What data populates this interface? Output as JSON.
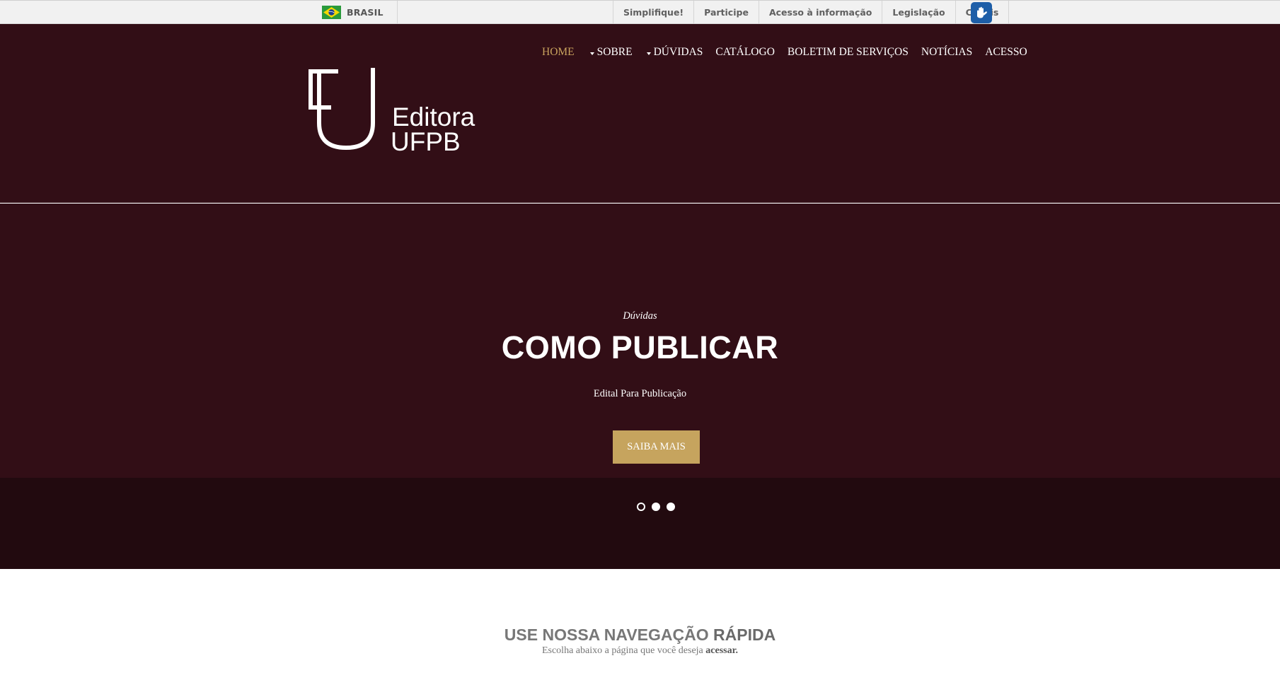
{
  "gov_bar": {
    "country_label": "BRASIL",
    "flag_icon": "brazil-flag-icon",
    "links": [
      "Simplifique!",
      "Participe",
      "Acesso à informação",
      "Legislação",
      "Canais"
    ],
    "accessibility_icon": "vlibras-hands-icon"
  },
  "header": {
    "nav": {
      "home": "HOME",
      "sobre": "SOBRE",
      "duvidas": "DÚVIDAS",
      "catalogo": "CATÁLOGO",
      "boletim": "BOLETIM DE SERVIÇOS",
      "noticias": "NOTÍCIAS",
      "acesso": "ACESSO"
    },
    "logo": {
      "line1": "Editora",
      "line2": "UFPB"
    }
  },
  "hero": {
    "kicker": "Dúvidas",
    "title": "COMO PUBLICAR",
    "subtitle": "Edital Para Publicação",
    "button": "SAIBA MAIS",
    "slides_total": 3,
    "current_slide": 1
  },
  "quick_nav": {
    "title_prefix": "USE NOSSA NAVEGAÇÃO",
    "title_strong": "RÁPIDA",
    "subtitle_prefix": "Escolha abaixo a página que você deseja",
    "subtitle_strong": "acessar."
  },
  "colors": {
    "header_bg": "#320e16",
    "slider_strip_bg": "#220a0f",
    "accent_gold": "#c6a45e",
    "gov_bar_bg": "#f1f1f1",
    "vlibras_blue": "#1d5ea8"
  }
}
